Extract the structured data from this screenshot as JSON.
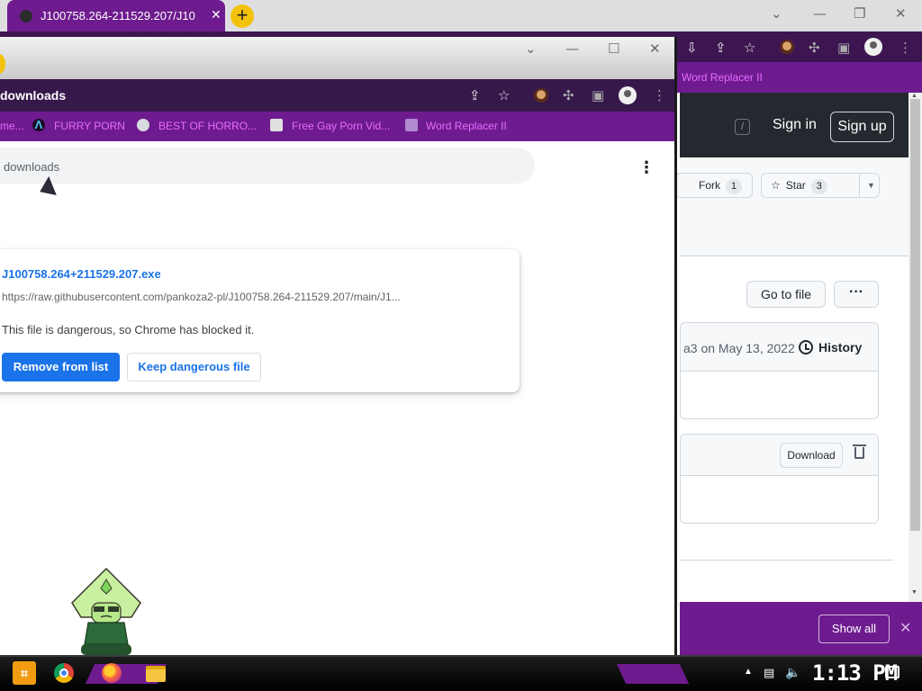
{
  "back_window": {
    "tab_title": "J100758.264-211529.207/J10",
    "tab_close": "✕",
    "new_tab": "+",
    "window_controls": {
      "chevron": "⌄",
      "minimize": "—",
      "restore": "❐",
      "close": "✕"
    },
    "bookmark": "Word Replacer II",
    "search_shortcut": "/",
    "sign_in": "Sign in",
    "sign_up": "Sign up",
    "fork_label": "Fork",
    "fork_count": "1",
    "star_label": "Star",
    "star_count": "3",
    "go_to_file": "Go to file",
    "more": "···",
    "commit_text": "a3 on May 13, 2022",
    "history": "History",
    "download": "Download",
    "show_all": "Show all",
    "dl_bar_close": "✕"
  },
  "front_window": {
    "window_controls": {
      "chevron": "⌄",
      "minimize": "—",
      "restore": "☐",
      "close": "✕"
    },
    "address": "downloads",
    "bookmarks": [
      {
        "label": "me..."
      },
      {
        "label": "FURRY PORN"
      },
      {
        "label": "BEST OF HORRO..."
      },
      {
        "label": "Free Gay Porn Vid..."
      },
      {
        "label": "Word Replacer II"
      }
    ],
    "search_placeholder": "downloads",
    "download_item": {
      "filename": "J100758.264+211529.207.exe",
      "url": "https://raw.githubusercontent.com/pankoza2-pl/J100758.264-211529.207/main/J1...",
      "warning": "This file is dangerous, so Chrome has blocked it.",
      "remove_label": "Remove from list",
      "keep_label": "Keep dangerous file"
    }
  },
  "taskbar": {
    "clock": "1:13 PM"
  }
}
